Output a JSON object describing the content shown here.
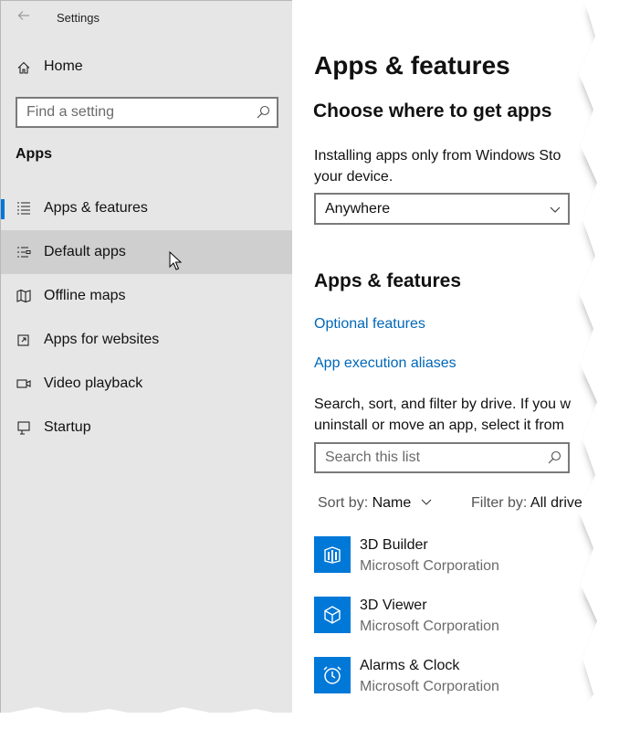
{
  "window": {
    "title": "Settings"
  },
  "sidebar": {
    "home_label": "Home",
    "search_placeholder": "Find a setting",
    "section_label": "Apps",
    "items": [
      {
        "label": "Apps & features",
        "icon": "list-icon",
        "selected": true
      },
      {
        "label": "Default apps",
        "icon": "default-apps-icon",
        "hovered": true
      },
      {
        "label": "Offline maps",
        "icon": "map-icon"
      },
      {
        "label": "Apps for websites",
        "icon": "open-link-icon"
      },
      {
        "label": "Video playback",
        "icon": "video-icon"
      },
      {
        "label": "Startup",
        "icon": "startup-icon"
      }
    ]
  },
  "main": {
    "title": "Apps & features",
    "choose_heading": "Choose where to get apps",
    "choose_desc_line1": "Installing apps only from Windows Sto",
    "choose_desc_line2": "your device.",
    "source_dropdown_value": "Anywhere",
    "features_heading": "Apps & features",
    "optional_features_link": "Optional features",
    "execution_aliases_link": "App execution aliases",
    "list_desc_line1": "Search, sort, and filter by drive. If you w",
    "list_desc_line2": "uninstall or move an app, select it from",
    "list_search_placeholder": "Search this list",
    "sort_label": "Sort by:",
    "sort_value": "Name",
    "filter_label": "Filter by:",
    "filter_value": "All drive",
    "apps": [
      {
        "name": "3D Builder",
        "publisher": "Microsoft Corporation",
        "icon": "3d-builder-icon"
      },
      {
        "name": "3D Viewer",
        "publisher": "Microsoft Corporation",
        "icon": "3d-viewer-icon"
      },
      {
        "name": "Alarms & Clock",
        "publisher": "Microsoft Corporation",
        "icon": "alarm-clock-icon"
      }
    ]
  },
  "colors": {
    "sidebar_bg": "#e6e6e6",
    "hover_bg": "#cfcfcf",
    "accent": "#0078d7",
    "link": "#0067b8"
  }
}
